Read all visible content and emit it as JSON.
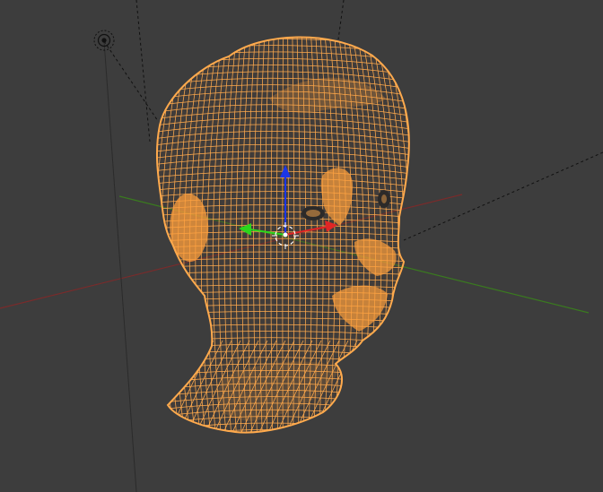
{
  "viewport": {
    "background": "#3d3d3d",
    "wire_color": "#ffaa4d",
    "x_axis_color": "#8a2a2a",
    "y_axis_color": "#3f7a1e",
    "gizmo_x_color": "#e02525",
    "gizmo_y_color": "#2bd61c",
    "gizmo_z_color": "#1c36e6",
    "selected_object": "head-mesh",
    "display_mode": "wireframe",
    "icons": {
      "lamp": "lamp-icon",
      "camera_lines": "camera-frustum-lines",
      "gizmo": "transform-gizmo",
      "cursor": "3d-cursor-icon"
    }
  }
}
